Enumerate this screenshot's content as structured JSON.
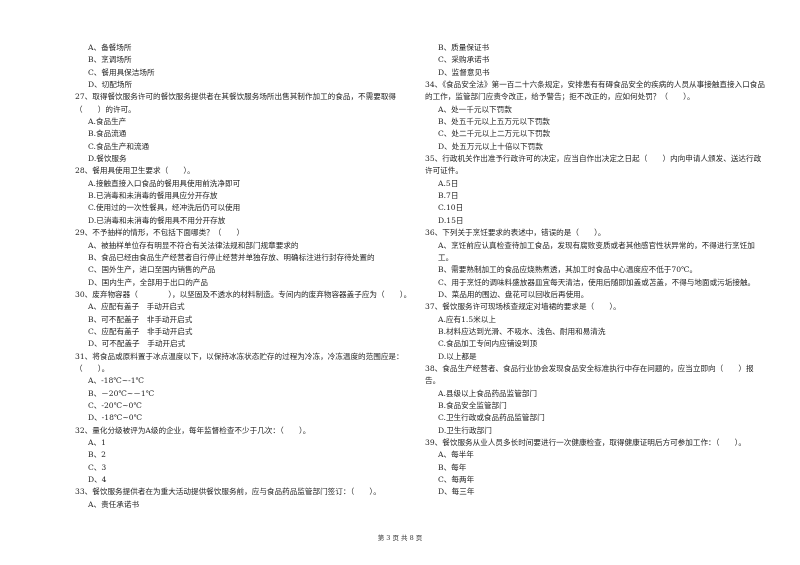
{
  "left_column": {
    "carryover_options": [
      "A、备餐场所",
      "B、烹调场所",
      "C、餐用具保洁场所",
      "D、切配场所"
    ],
    "questions": [
      {
        "stem": "27、取得餐饮服务许可的餐饮服务提供者在其餐饮服务场所出售其制作加工的食品，不需要取得（　　）的许可。",
        "options": [
          "A.食品生产",
          "B.食品流通",
          "C.食品生产和流通",
          "D.餐饮服务"
        ]
      },
      {
        "stem": "28、餐用具使用卫生要求（　　）。",
        "options": [
          "A.接触直接入口食品的餐用具使用前洗净即可",
          "B.已消毒和未消毒的餐用具应分开存放",
          "C.使用过的一次性餐具，经冲洗后仍可以使用",
          "D.已消毒和未消毒的餐用具不用分开存放"
        ]
      },
      {
        "stem": "29、不予抽样的情形，不包括下面哪类？（　　）",
        "options": [
          "A、被抽样单位存有明显不符合有关法律法规和部门规章要求的",
          "B、食品已经由食品生产经营者自行停止经营并单独存放、明确标注进行封存待处置的",
          "C、国外生产，进口至国内销售的产品",
          "D、国内生产，全部用于出口的产品"
        ]
      },
      {
        "stem": "30、废弃物容器（　　　　），以坚固及不透水的材料制造。专间内的废弃物容器盖子应为（　　）。",
        "options": [
          "A、应配有盖子　手动开启式",
          "B、可不配盖子　非手动开启式",
          "C、应配有盖子　非手动开启式",
          "D、可不配盖子　手动开启式"
        ]
      },
      {
        "stem": "31、将食品或原料置于冰点温度以下，以保持冰冻状态贮存的过程为冷冻，冷冻温度的范围应是：（　　）。",
        "options": [
          "A、-18℃~-1℃",
          "B、－20℃~－1℃",
          "C、-20℃~0℃",
          "D、-18℃~0℃"
        ]
      },
      {
        "stem": "32、量化分级被评为A级的企业，每年监督检查不少于几次：（　　）。",
        "options": [
          "A、1",
          "B、2",
          "C、3",
          "D、4"
        ]
      },
      {
        "stem": "33、餐饮服务提供者在为重大活动提供餐饮服务前，应与食品药品监管部门签订：（　　）。",
        "options": [
          "A、责任承诺书"
        ]
      }
    ]
  },
  "right_column": {
    "carryover_options": [
      "B、质量保证书",
      "C、采购承诺书",
      "D、监督意见书"
    ],
    "questions": [
      {
        "stem": "34、《食品安全法》第一百二十六条规定，安排患有有碍食品安全的疾病的人员从事接触直接入口食品的工作，监管部门应责令改正，给予警告；拒不改正的，应如何处罚？（　　）。",
        "options": [
          "A、处一千元以下罚款",
          "B、处五千元以上五万元以下罚款",
          "C、处二千元以上二万元以下罚款",
          "D、处五万元以上十倍以下罚款"
        ]
      },
      {
        "stem": "35、行政机关作出准予行政许可的决定，应当自作出决定之日起（　　）内向申请人颁发、送达行政许可证件。",
        "options": [
          "A.5日",
          "B.7日",
          "C.10日",
          "D.15日"
        ]
      },
      {
        "stem": "36、下列关于烹饪要求的表述中，错误的是（　　）。",
        "options": [
          "A、烹饪前应认真检查待加工食品，发现有腐败变质或者其他感官性状异常的，不得进行烹饪加工。",
          "B、需要熟制加工的食品应烧熟煮透，其加工时食品中心温度应不低于70℃。",
          "C、用于烹饪的调味料盛放器皿宜每天清洁，使用后随即加盖或苫盖，不得与地面或污垢接触。",
          "D、菜品用的围边、盘花可以回收后再使用。"
        ]
      },
      {
        "stem": "37、餐饮服务许可现场核查规定对墙裙的要求是（　　）。",
        "options": [
          "A.应有1.5米以上",
          "B.材料应达到光滑、不吸水、浅色、耐用和易清洗",
          "C.食品加工专间内应铺设到顶",
          "D.以上都是"
        ]
      },
      {
        "stem": "38、食品生产经营者、食品行业协会发现食品安全标准执行中存在问题的，应当立即向（　　）报告。",
        "options": [
          "A.县级以上食品药品监管部门",
          "B.食品安全监管部门",
          "C.卫生行政或食品药品监管部门",
          "D.卫生行政部门"
        ]
      },
      {
        "stem": "39、餐饮服务从业人员多长时间要进行一次健康检查，取得健康证明后方可参加工作：（　　）。",
        "options": [
          "A、每半年",
          "B、每年",
          "C、每两年",
          "D、每三年"
        ]
      }
    ]
  },
  "footer": {
    "page_label": "第 3 页 共 8 页"
  }
}
